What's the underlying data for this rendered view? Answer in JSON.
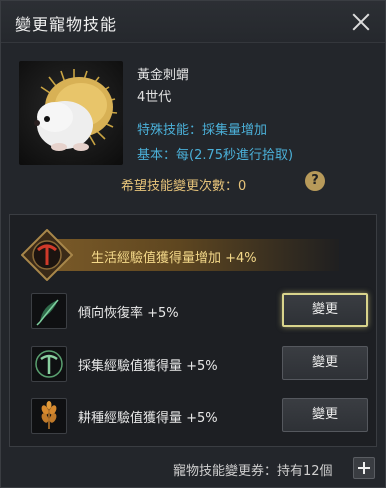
{
  "window": {
    "title": "變更寵物技能"
  },
  "pet": {
    "name": "黃金刺蝟",
    "generation": "4世代",
    "special_skill": "特殊技能：採集量增加",
    "basic": "基本：每(2.75秒進行拾取)",
    "wish_change_label": "希望技能變更次數：0"
  },
  "main_skill": {
    "text": "生活經驗值獲得量增加 +4%"
  },
  "skills": [
    {
      "text": "傾向恢復率 +5%",
      "button": "變更",
      "icon": "feather-icon"
    },
    {
      "text": "採集經驗值獲得量 +5%",
      "button": "變更",
      "icon": "pickaxe-icon"
    },
    {
      "text": "耕種經驗值獲得量 +5%",
      "button": "變更",
      "icon": "wheat-icon"
    }
  ],
  "footer": {
    "coupon_text": "寵物技能變更券：持有12個"
  },
  "colors": {
    "accent_blue": "#4bb0d8",
    "accent_gold": "#e6c37a",
    "highlight": "#d9d48c"
  }
}
